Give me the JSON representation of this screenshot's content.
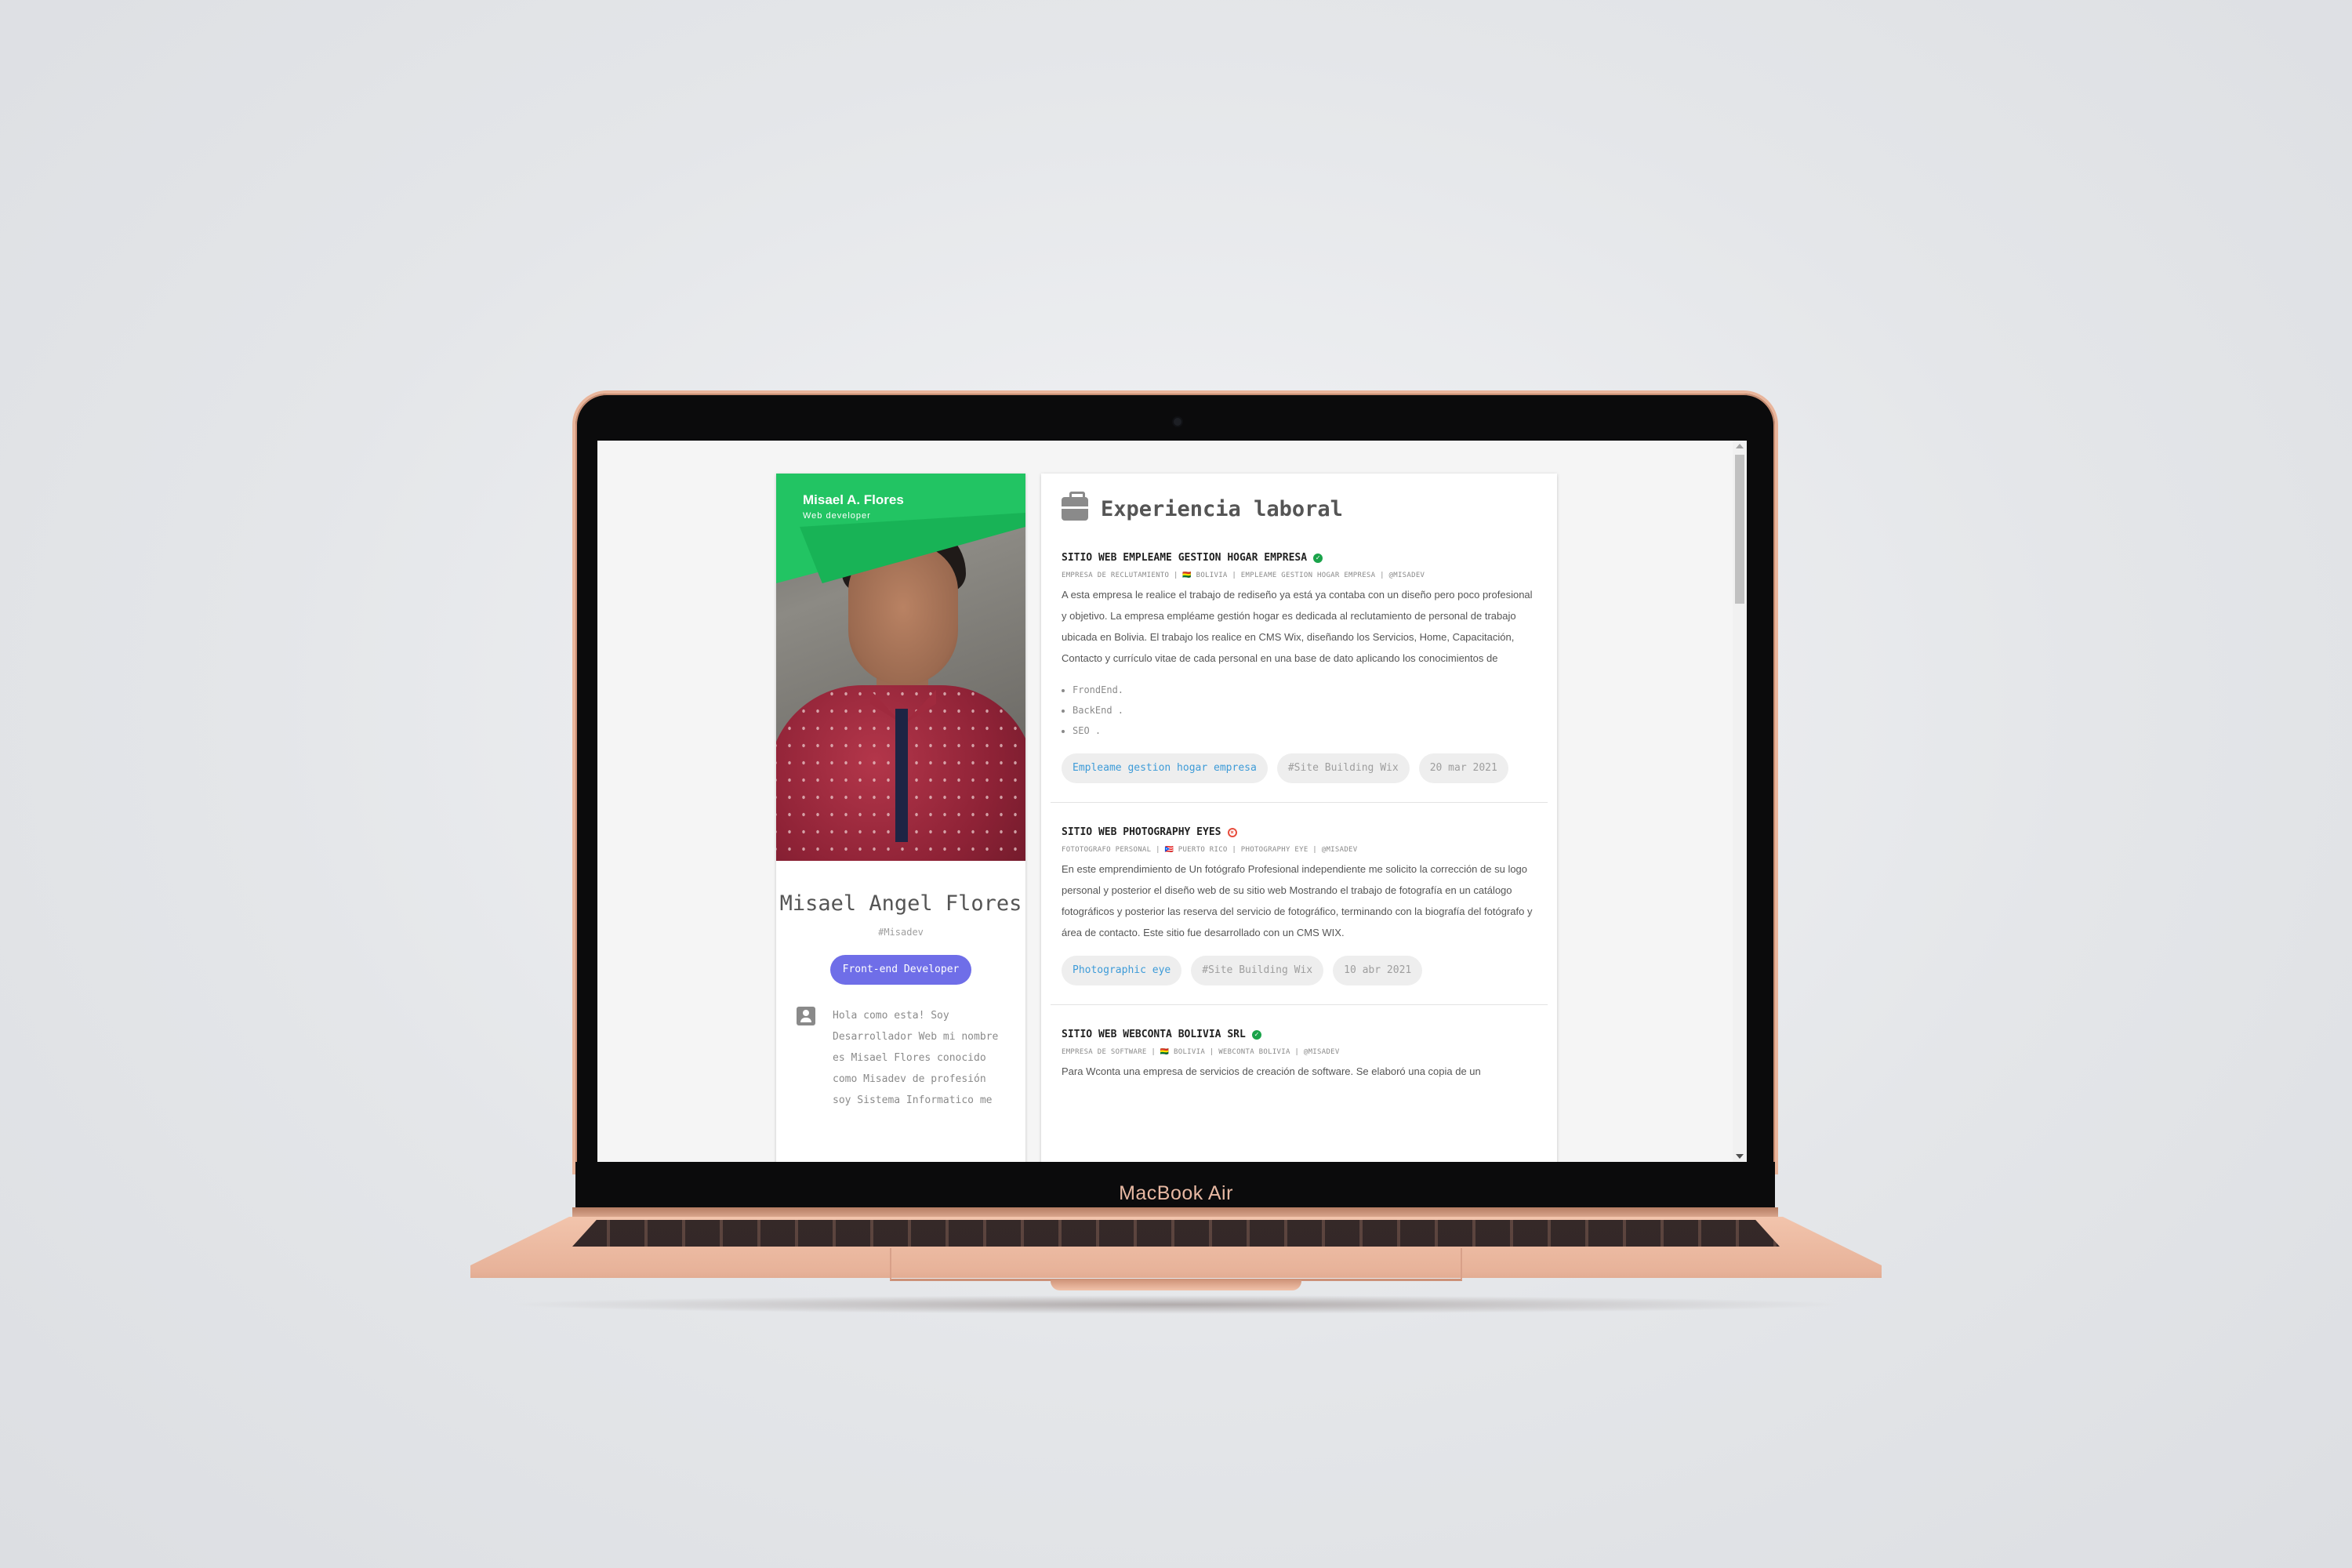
{
  "device": {
    "brand_label": "MacBook Air"
  },
  "profile": {
    "banner_name": "Misael A. Flores",
    "banner_role": "Web developer",
    "full_name": "Misael Angel Flores",
    "handle": "#Misadev",
    "role_chip": "Front-end Developer",
    "bio": "Hola como esta! Soy Desarrollador Web mi nombre es Misael Flores conocido como Misadev de profesión soy Sistema Informatico me"
  },
  "experience": {
    "section_title": "Experiencia laboral",
    "jobs": [
      {
        "title": "SITIO WEB EMPLEAME GESTION HOGAR EMPRESA",
        "status": "ok",
        "meta": "EMPRESA DE RECLUTAMIENTO | 🇧🇴 BOLIVIA | EMPLEAME GESTION HOGAR EMPRESA | @MISADEV",
        "description": "A esta empresa le realice el trabajo de rediseño ya está ya contaba con un diseño pero poco profesional y objetivo. La empresa empléame gestión hogar es dedicada al reclutamiento de personal de trabajo ubicada en Bolivia. El trabajo los realice en CMS Wix, diseñando los Servicios, Home, Capacitación, Contacto y currículo vitae de cada personal en una base de dato aplicando los conocimientos de",
        "skills": [
          "FrondEnd.",
          "BackEnd .",
          "SEO ."
        ],
        "tags": [
          "Empleame gestion hogar empresa",
          "#Site Building Wix",
          "20 mar 2021"
        ]
      },
      {
        "title": "SITIO WEB PHOTOGRAPHY EYES",
        "status": "error",
        "meta": "FOTOTOGRAFO PERSONAL | 🇵🇷 PUERTO RICO | PHOTOGRAPHY EYE | @MISADEV",
        "description": "En este emprendimiento de Un fotógrafo Profesional independiente me solicito la corrección de su logo personal y posterior el diseño web de su sitio web Mostrando el trabajo de fotografía en un catálogo fotográficos y posterior las reserva del servicio de fotográfico, terminando con la biografía del fotógrafo y área de contacto. Este sitio fue desarrollado con un CMS WIX.",
        "tags": [
          "Photographic eye",
          "#Site Building Wix",
          "10 abr 2021"
        ]
      },
      {
        "title": "SITIO WEB WEBCONTA BOLIVIA SRL",
        "status": "ok",
        "meta": "EMPRESA DE SOFTWARE | 🇧🇴 BOLIVIA | WEBCONTA BOLIVIA | @MISADEV",
        "description": "Para Wconta una empresa de servicios de creación de software. Se elaboró una copia de un"
      }
    ]
  },
  "colors": {
    "accent_green": "#22c463",
    "chip_purple": "#6f6ee8",
    "link_blue": "#3d9bd8",
    "laptop_gold": "#e9b59b"
  }
}
